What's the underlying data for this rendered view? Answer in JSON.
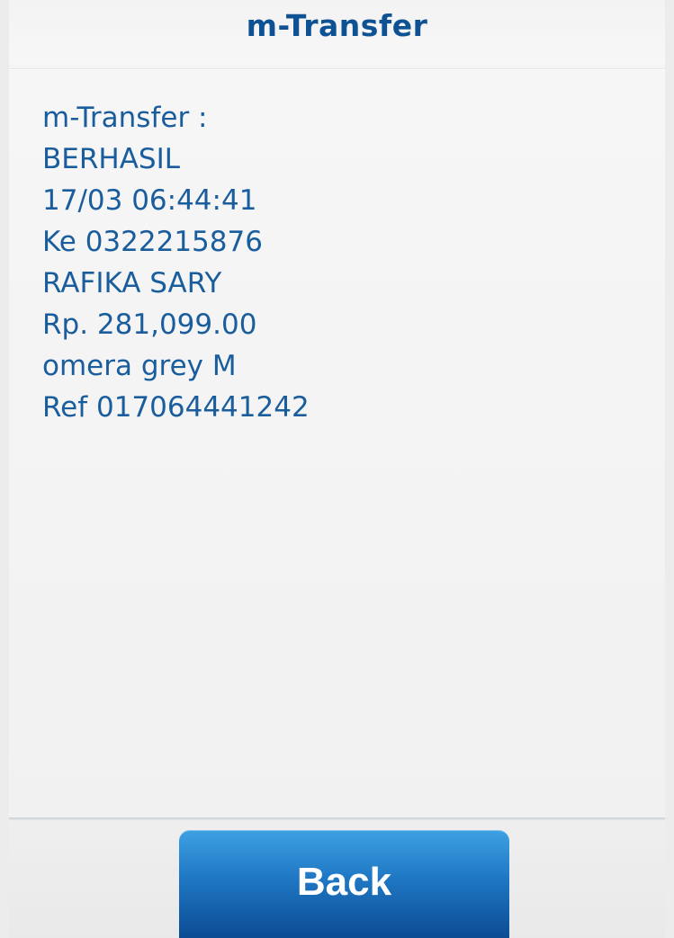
{
  "header": {
    "title": "m-Transfer"
  },
  "message": {
    "lines": [
      "m-Transfer :",
      "BERHASIL",
      "17/03 06:44:41",
      "Ke 0322215876",
      "RAFIKA SARY",
      "Rp. 281,099.00",
      "omera grey M",
      "Ref 017064441242"
    ]
  },
  "footer": {
    "back_label": "Back"
  },
  "colors": {
    "text": "#1a5d9d",
    "title": "#0e5294",
    "button_top": "#3ea1e3",
    "button_bottom": "#0c4c93"
  }
}
